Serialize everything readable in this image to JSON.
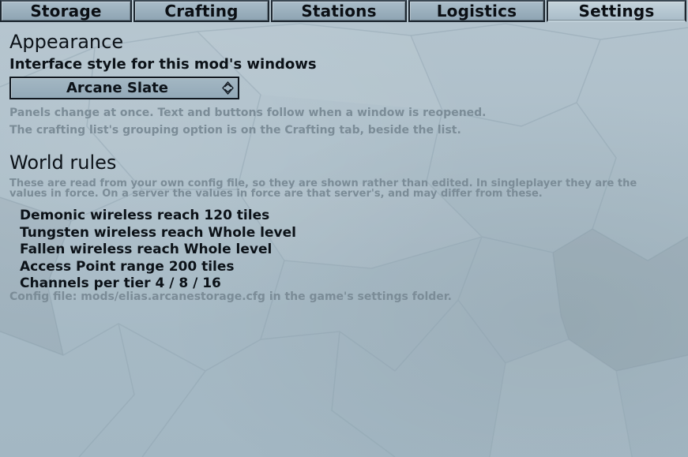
{
  "tabs": [
    {
      "label": "Storage",
      "active": false
    },
    {
      "label": "Crafting",
      "active": false
    },
    {
      "label": "Stations",
      "active": false
    },
    {
      "label": "Logistics",
      "active": false
    },
    {
      "label": "Settings",
      "active": true
    }
  ],
  "appearance": {
    "heading": "Appearance",
    "style_label": "Interface style for this mod's windows",
    "style_value": "Arcane Slate",
    "note1": "Panels change at once. Text and buttons follow when a window is reopened.",
    "note2": "The crafting list's grouping option is on the Crafting tab, beside the list."
  },
  "world_rules": {
    "heading": "World rules",
    "description": "These are read from your own config file, so they are shown rather than edited. In singleplayer they are the values in force. On a server the values in force are that server's, and may differ from these.",
    "rules": [
      {
        "name": "Demonic wireless reach",
        "value": "120 tiles"
      },
      {
        "name": "Tungsten wireless reach",
        "value": "Whole level"
      },
      {
        "name": "Fallen wireless reach",
        "value": "Whole level"
      },
      {
        "name": "Access Point range",
        "value": "200 tiles"
      },
      {
        "name": "Channels per tier",
        "value": "4 / 8 / 16"
      }
    ],
    "config_file": "Config file: mods/elias.arcanestorage.cfg in the game's settings folder."
  },
  "colors": {
    "background": "#aebfc9",
    "text": "#0c1218",
    "muted_text": "#7b8c97",
    "border": "#111820"
  },
  "icons": {
    "select_arrow": "up-down-chevron-icon"
  }
}
